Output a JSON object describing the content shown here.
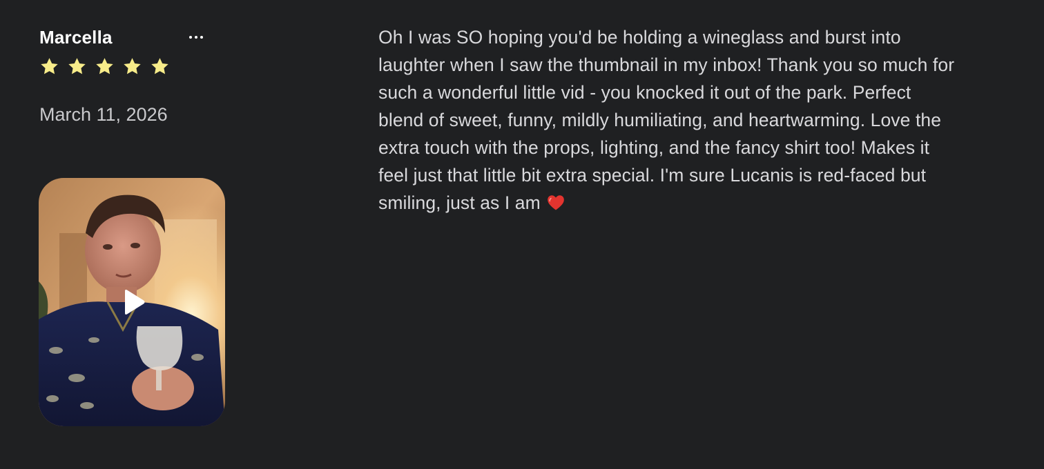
{
  "review": {
    "reviewer_name": "Marcella",
    "rating": 5,
    "rating_max": 5,
    "date": "March 11, 2026",
    "text_lines": [
      "Oh I was SO hoping you'd be holding a wineglass and burst into",
      "laughter when I saw the thumbnail in my inbox! Thank you so much for",
      "such a wonderful little vid - you knocked it out of the park. Perfect",
      "blend of sweet, funny, mildly humiliating, and heartwarming. Love the",
      "extra touch with the props, lighting, and the fancy shirt too! Makes it",
      "feel just that little bit extra special. I'm sure Lucanis is red-faced but",
      "smiling, just as I am"
    ],
    "text_end_emoji": "heart-icon",
    "video": {
      "icon": "play-icon"
    },
    "menu_icon": "more-options-icon"
  },
  "colors": {
    "background": "#1f2022",
    "star": "#f7ec8a",
    "name": "#ffffff",
    "text": "#d9d9dc",
    "heart": "#e3342f"
  }
}
